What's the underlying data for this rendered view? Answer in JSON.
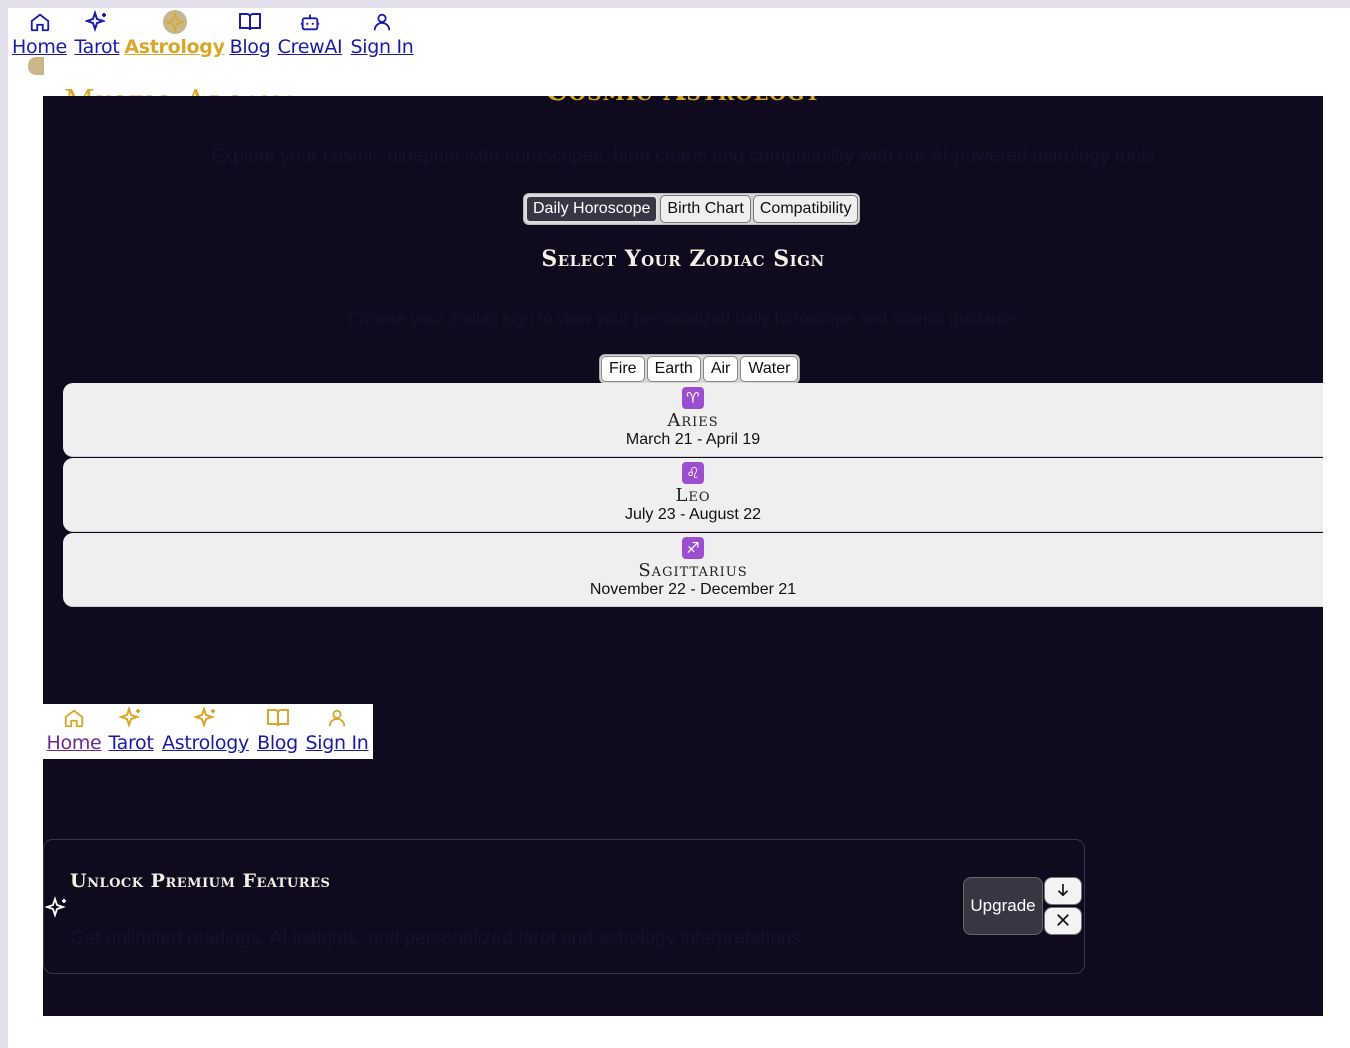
{
  "top_nav": [
    {
      "label": "Home",
      "icon": "home-icon"
    },
    {
      "label": "Tarot",
      "icon": "sparkles-icon"
    },
    {
      "label": "Astrology",
      "icon": "star-icon",
      "active": true
    },
    {
      "label": "Blog",
      "icon": "book-icon"
    },
    {
      "label": "CrewAI",
      "icon": "bot-icon"
    },
    {
      "label": "Sign In",
      "icon": "user-icon"
    }
  ],
  "logo_fragment": "Mystic Arcana",
  "page": {
    "title": "Cosmic Astrology",
    "subtitle": "Explore your cosmic blueprint with horoscopes, birth charts and compatibility with our AI-powered astrology tools",
    "tabs": [
      "Daily Horoscope",
      "Birth Chart",
      "Compatibility"
    ],
    "section_title": "Select Your Zodiac Sign",
    "section_subtitle": "Choose your zodiac sign to view your personalized daily horoscope and cosmic guidance",
    "elements": [
      "Fire",
      "Earth",
      "Air",
      "Water"
    ]
  },
  "signs": [
    {
      "glyph": "♈",
      "name": "Aries",
      "dates": "March 21 - April 19"
    },
    {
      "glyph": "♌",
      "name": "Leo",
      "dates": "July 23 - August 22"
    },
    {
      "glyph": "♐",
      "name": "Sagittarius",
      "dates": "November 22 - December 21"
    }
  ],
  "bottom_nav": [
    {
      "label": "Home",
      "icon": "home-icon"
    },
    {
      "label": "Tarot",
      "icon": "sparkles-icon"
    },
    {
      "label": "Astrology",
      "icon": "sparkles-icon"
    },
    {
      "label": "Blog",
      "icon": "book-icon"
    },
    {
      "label": "Sign In",
      "icon": "user-icon"
    }
  ],
  "premium": {
    "title": "Unlock Premium Features",
    "description": "Get unlimited readings, AI insights, and personalized tarot and astrology interpretations",
    "upgrade_label": "Upgrade"
  },
  "colors": {
    "accent": "#d9a82a",
    "panel": "#0f0a1e",
    "link": "#1a1aa6"
  }
}
